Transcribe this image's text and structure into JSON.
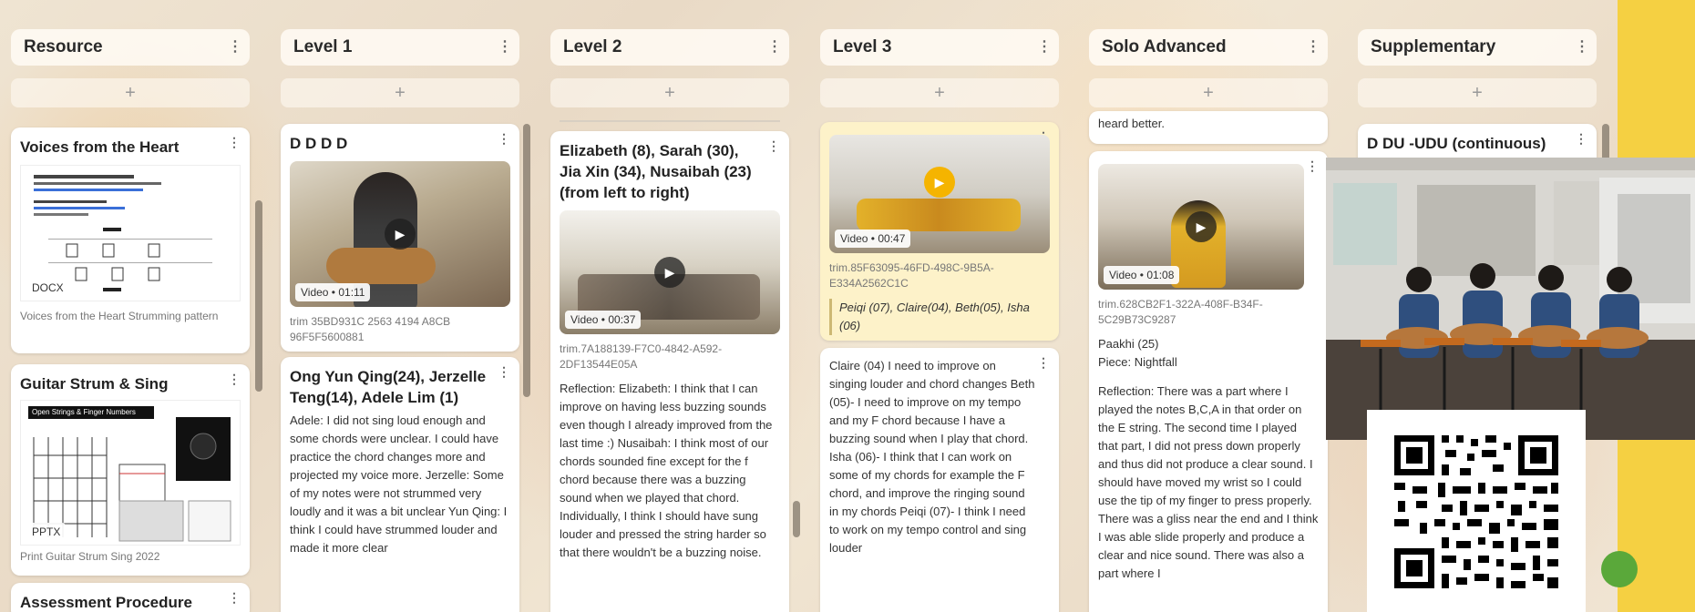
{
  "columns": [
    {
      "title": "Resource"
    },
    {
      "title": "Level 1"
    },
    {
      "title": "Level 2"
    },
    {
      "title": "Level 3"
    },
    {
      "title": "Solo Advanced"
    },
    {
      "title": "Supplementary"
    }
  ],
  "kebab": "⋮",
  "add": "+",
  "resource": {
    "card1_title": "Voices from the Heart",
    "card1_badge": "DOCX",
    "card1_caption": "Voices from the Heart Strumming pattern",
    "card2_title": "Guitar Strum & Sing",
    "card2_badge": "PPTX",
    "card2_caption": "Print Guitar Strum Sing 2022",
    "card2_doc_header": "Open Strings & Finger Numbers",
    "card3_title": "Assessment Procedure"
  },
  "level1": {
    "card1_title": "D D D D",
    "card1_video": "Video • 01:11",
    "card1_file": "trim 35BD931C 2563 4194 A8CB 96F5F5600881",
    "card2_title": "Ong Yun Qing(24), Jerzelle Teng(14), Adele Lim (1)",
    "card2_body": "Adele: I did not sing loud enough and some chords were unclear. I could have practice the chord changes more and projected my voice more. Jerzelle: Some of my notes were not strummed very loudly and it was a bit unclear Yun Qing: I think I could have strummed louder and made it more clear"
  },
  "level2": {
    "card1_title": "Elizabeth (8), Sarah (30), Jia Xin (34), Nusaibah (23) (from left to right)",
    "card1_video": "Video • 00:37",
    "card1_file": "trim.7A188139-F7C0-4842-A592-2DF13544E05A",
    "card1_body": "Reflection: Elizabeth: I think that I can improve on having less buzzing sounds even though I already improved from the last time :) Nusaibah: I think most of our chords sounded fine except for the f chord because there was a buzzing sound when we played that chord. Individually, I think I should have sung louder and pressed the string harder so that there wouldn't be a buzzing noise."
  },
  "level3": {
    "card1_video": "Video • 00:47",
    "card1_file": "trim.85F63095-46FD-498C-9B5A-E334A2562C1C",
    "card1_quote": "Peiqi (07), Claire(04), Beth(05), Isha (06)",
    "card2_body": "Claire (04) I need to improve on singing louder and chord changes Beth (05)- I need to improve on my tempo and my F chord because I have a buzzing sound when I play that chord. Isha (06)- I think that I can work on some of my chords for example the F chord, and improve the ringing sound in my chords Peiqi (07)- I think I need to work on my tempo control and sing louder"
  },
  "solo": {
    "card0_text": "heard better.",
    "card1_video": "Video • 01:08",
    "card1_file": "trim.628CB2F1-322A-408F-B34F-5C29B73C9287",
    "card1_name": "Paakhi (25)",
    "card1_piece": "Piece: Nightfall",
    "card1_body": "Reflection: There was a part where I played the notes B,C,A in that order on the E string. The second time I played that part, I did not press down properly and thus did not produce a clear sound. I should have moved my wrist so I could use the tip of my finger to press properly. There was a gliss near the end and I think I was able slide properly and produce a clear and nice sound. There was also a part where I"
  },
  "supplementary": {
    "card1_title": "D DU -UDU (continuous)"
  },
  "colors": {
    "accent_yellow": "#f5d042",
    "card_yellow": "#fdf2c9",
    "play_yellow": "#f5b400"
  }
}
